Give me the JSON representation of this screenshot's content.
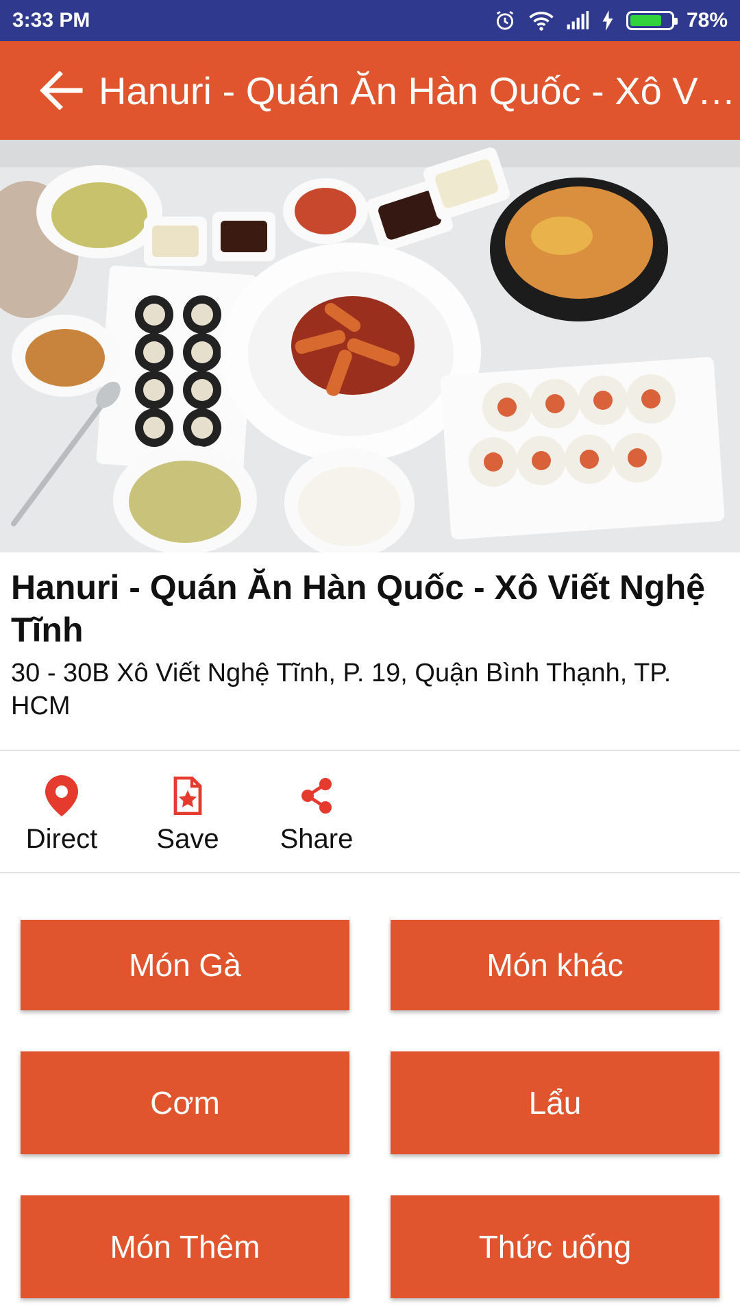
{
  "status_bar": {
    "time": "3:33 PM",
    "battery_percent": "78%",
    "battery_level": 0.78
  },
  "app_bar": {
    "title": "Hanuri - Quán Ăn Hàn Quốc - Xô Viế..."
  },
  "place": {
    "name": "Hanuri - Quán Ăn Hàn Quốc - Xô Viết Nghệ Tĩnh",
    "address": "30 - 30B Xô Viết Nghệ Tĩnh, P. 19, Quận Bình Thạnh, TP. HCM"
  },
  "actions": [
    {
      "label": "Direct",
      "icon": "location-pin-icon"
    },
    {
      "label": "Save",
      "icon": "bookmark-star-icon"
    },
    {
      "label": "Share",
      "icon": "share-icon"
    }
  ],
  "menu_categories": [
    "Món Gà",
    "Món khác",
    "Cơm",
    "Lẩu",
    "Món Thêm",
    "Thức uống"
  ],
  "colors": {
    "accent": "#e0552d",
    "status_bar": "#2f3a8f"
  }
}
